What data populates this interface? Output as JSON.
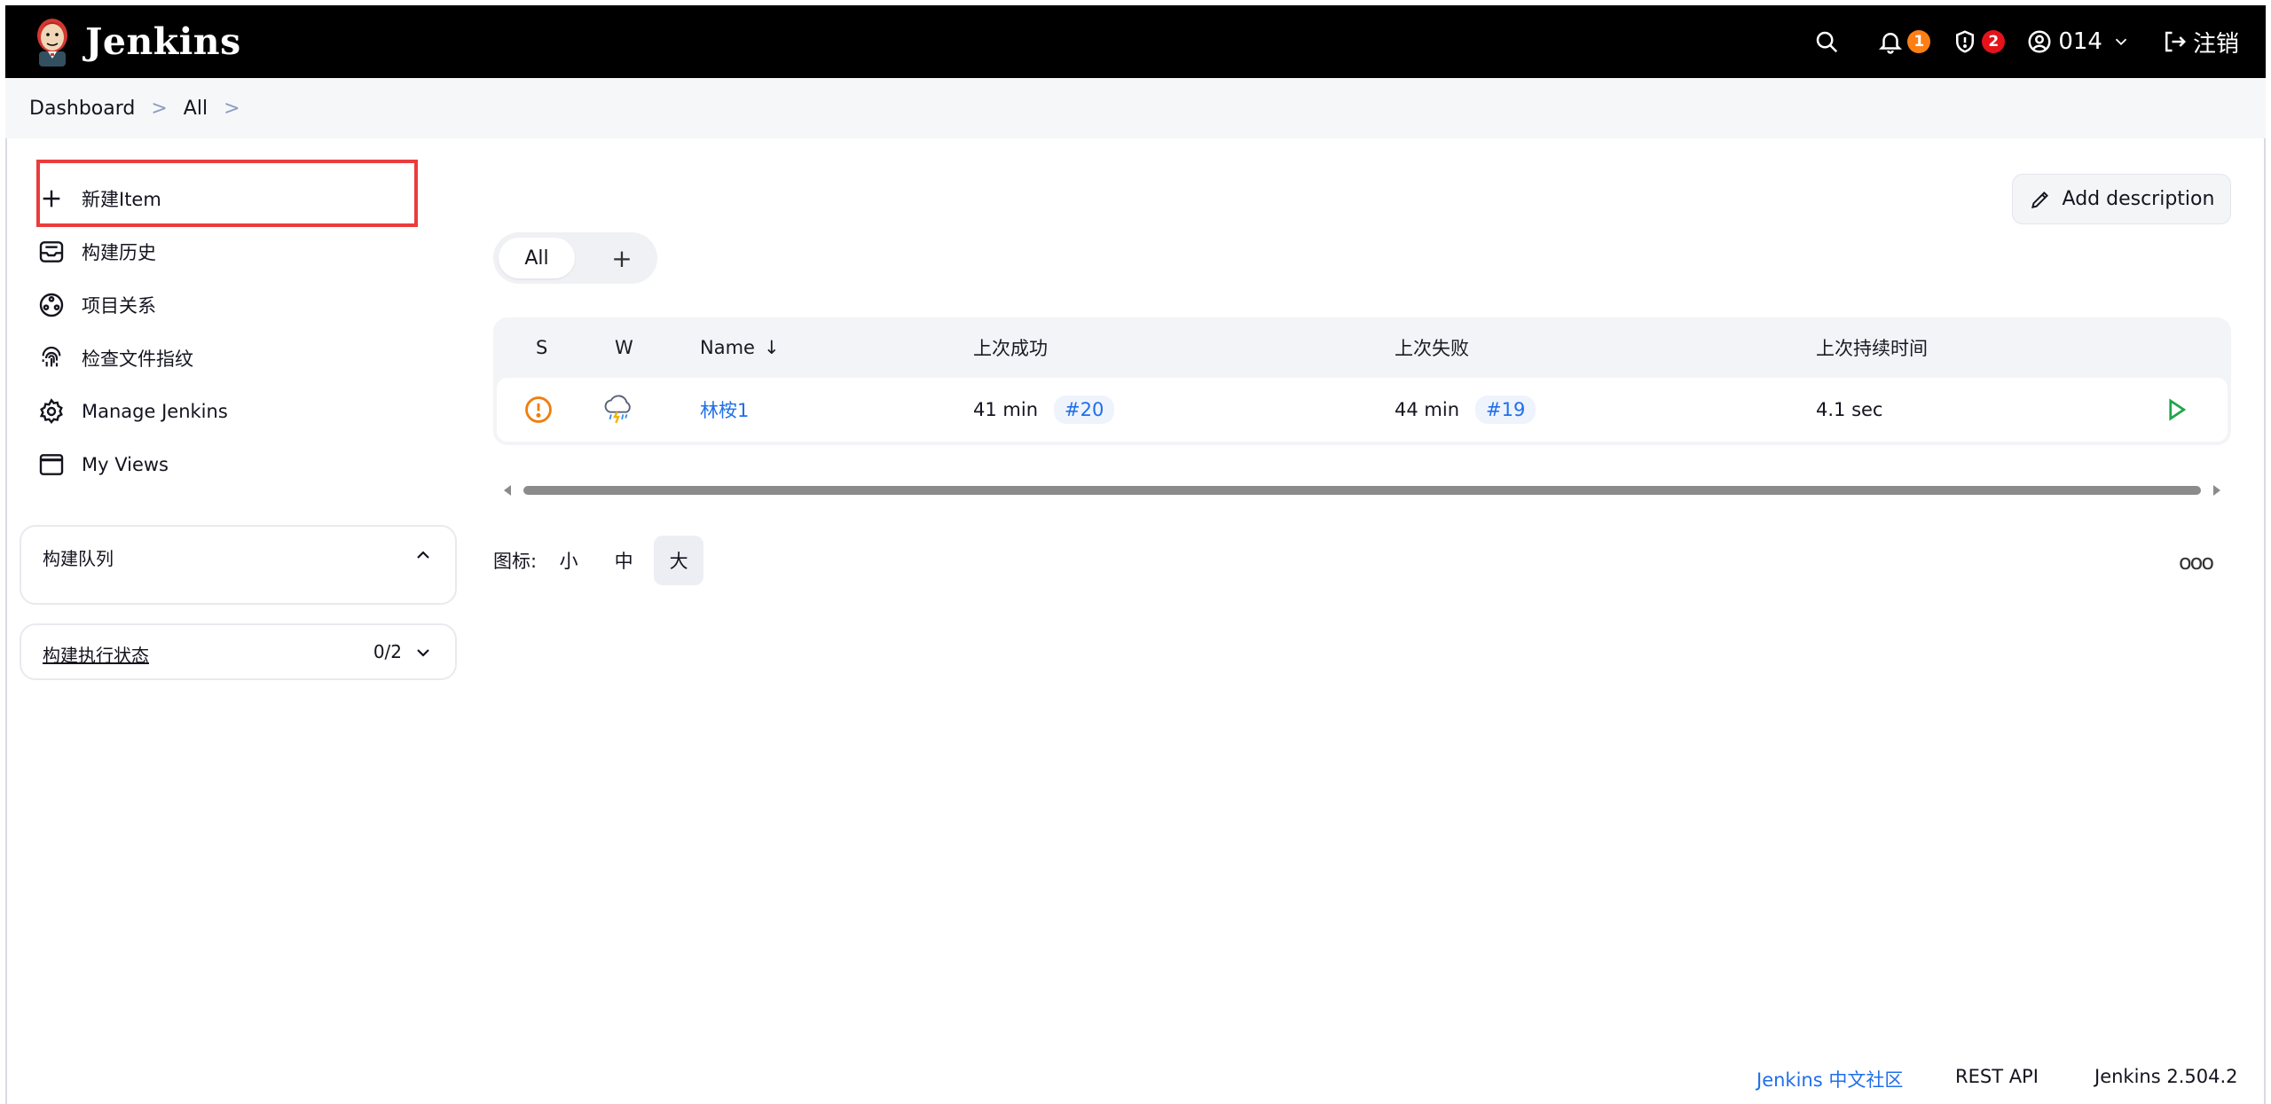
{
  "header": {
    "title": "Jenkins",
    "notifications_count": "1",
    "security_count": "2",
    "user": "014",
    "logout": "注销"
  },
  "breadcrumb": {
    "items": [
      "Dashboard",
      "All"
    ]
  },
  "sidebar": {
    "tasks": [
      {
        "label": "新建Item",
        "icon": "plus-icon"
      },
      {
        "label": "构建历史",
        "icon": "inbox-icon"
      },
      {
        "label": "项目关系",
        "icon": "relationship-icon"
      },
      {
        "label": "检查文件指纹",
        "icon": "fingerprint-icon"
      },
      {
        "label": "Manage Jenkins",
        "icon": "gear-icon"
      },
      {
        "label": "My Views",
        "icon": "window-icon"
      }
    ],
    "build_queue": {
      "title": "构建队列"
    },
    "executors": {
      "title": "构建执行状态",
      "count": "0/2"
    }
  },
  "main": {
    "add_description": "Add description",
    "tabs": {
      "all": "All",
      "add": "+"
    },
    "table": {
      "headers": {
        "s": "S",
        "w": "W",
        "name": "Name",
        "sort_arrow": "↓",
        "last_success": "上次成功",
        "last_failure": "上次失败",
        "last_duration": "上次持续时间"
      },
      "rows": [
        {
          "name": "林桉1",
          "last_success_time": "41 min",
          "last_success_build": "#20",
          "last_failure_time": "44 min",
          "last_failure_build": "#19",
          "duration": "4.1 sec"
        }
      ]
    },
    "icon_size": {
      "label": "图标:",
      "small": "小",
      "medium": "中",
      "large": "大"
    },
    "more": "ooo"
  },
  "footer": {
    "community": "Jenkins 中文社区",
    "rest_api": "REST API",
    "version": "Jenkins 2.504.2"
  },
  "colors": {
    "header_bg": "#000000",
    "link": "#1f6feb",
    "highlight": "#ea3c3c",
    "warning": "#f07e0c",
    "run": "#1ea64b"
  }
}
